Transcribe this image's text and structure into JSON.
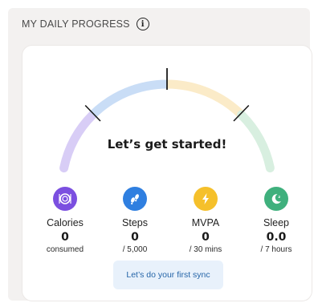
{
  "header": {
    "title": "MY DAILY PROGRESS",
    "info_icon": "i"
  },
  "progress": {
    "headline": "Let’s get started!",
    "gauge_colors": [
      "#d8cdf6",
      "#c9ddf6",
      "#fbebc8",
      "#d8efe0"
    ]
  },
  "metrics": [
    {
      "name": "Calories",
      "value": "0",
      "sub": "consumed",
      "icon": "plate-icon",
      "color": "#7b4fe0"
    },
    {
      "name": "Steps",
      "value": "0",
      "sub": "/ 5,000",
      "icon": "footsteps-icon",
      "color": "#2f7fe0"
    },
    {
      "name": "MVPA",
      "value": "0",
      "sub": "/ 30 mins",
      "icon": "lightning-icon",
      "color": "#f5c02b"
    },
    {
      "name": "Sleep",
      "value": "0.0",
      "sub": "/ 7 hours",
      "icon": "moon-icon",
      "color": "#3fb07d"
    }
  ],
  "sync_button": {
    "label": "Let’s do your first sync"
  }
}
